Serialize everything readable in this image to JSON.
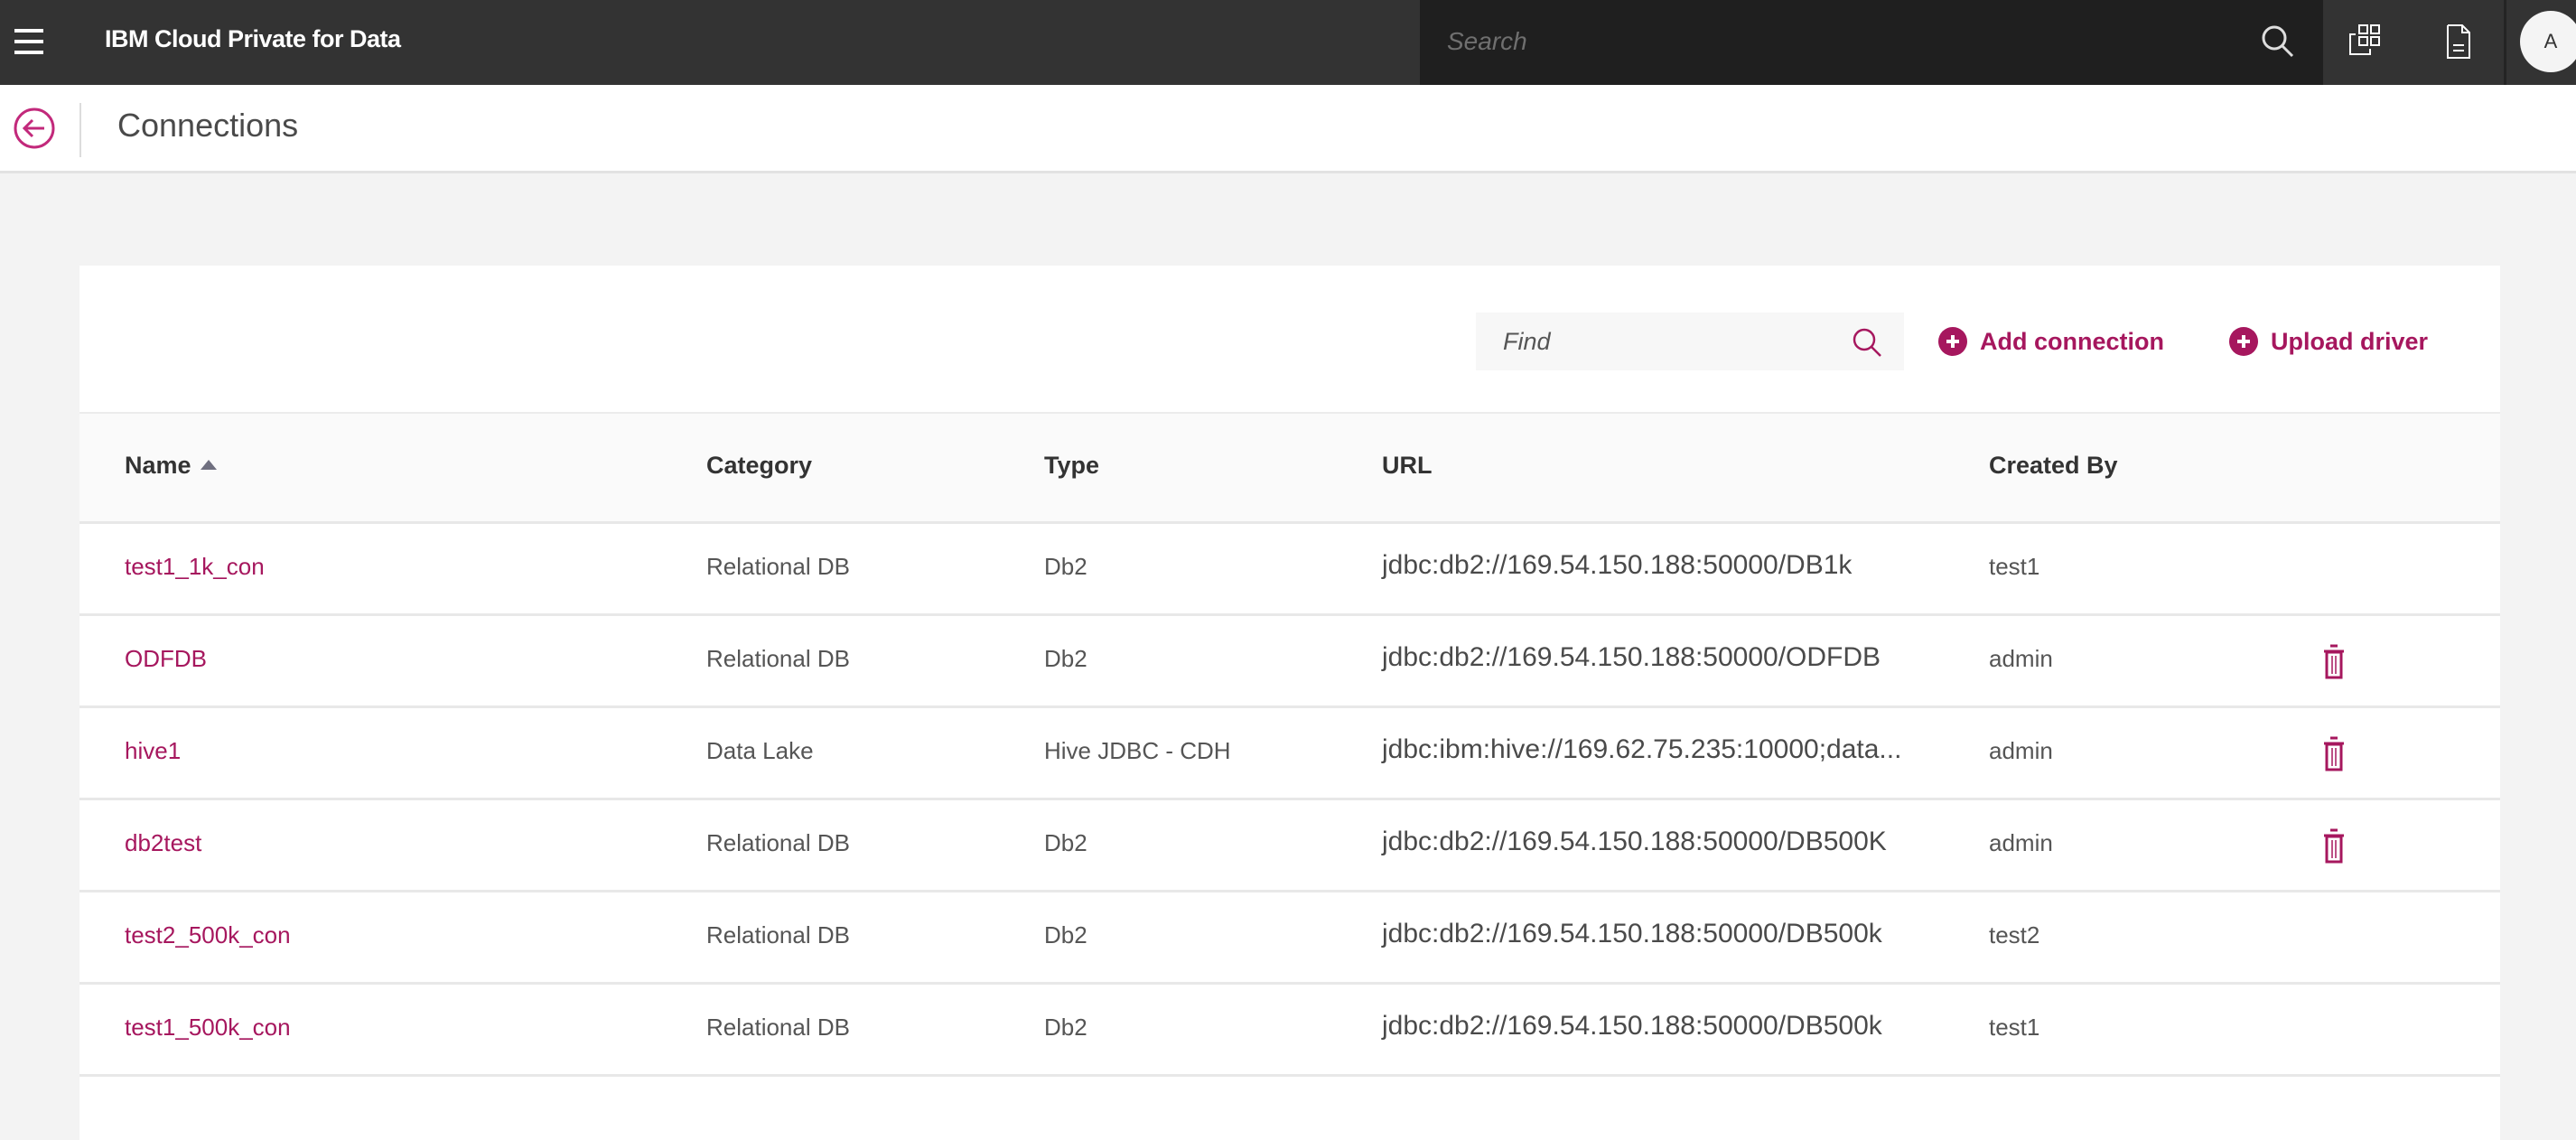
{
  "header": {
    "app_title": "IBM Cloud Private for Data",
    "search_placeholder": "Search",
    "avatar_initial": "A",
    "icons": [
      "menu-icon",
      "search-icon",
      "apps-icon",
      "document-icon"
    ]
  },
  "subheader": {
    "page_title": "Connections",
    "back_icon": "arrow-left-circle-icon"
  },
  "toolbar": {
    "find_placeholder": "Find",
    "add_connection_label": "Add connection",
    "upload_driver_label": "Upload driver"
  },
  "colors": {
    "accent": "#a6175e",
    "topbar": "#333333",
    "search_bg": "#1f1f1f"
  },
  "table": {
    "columns": [
      "Name",
      "Category",
      "Type",
      "URL",
      "Created By"
    ],
    "sort": {
      "column": "Name",
      "direction": "ascending"
    },
    "rows": [
      {
        "name": "test1_1k_con",
        "category": "Relational DB",
        "type": "Db2",
        "url": "jdbc:db2://169.54.150.188:50000/DB1k",
        "created_by": "test1",
        "deletable": false
      },
      {
        "name": "ODFDB",
        "category": "Relational DB",
        "type": "Db2",
        "url": "jdbc:db2://169.54.150.188:50000/ODFDB",
        "created_by": "admin",
        "deletable": true
      },
      {
        "name": "hive1",
        "category": "Data Lake",
        "type": "Hive JDBC - CDH",
        "url": "jdbc:ibm:hive://169.62.75.235:10000;data...",
        "created_by": "admin",
        "deletable": true
      },
      {
        "name": "db2test",
        "category": "Relational DB",
        "type": "Db2",
        "url": "jdbc:db2://169.54.150.188:50000/DB500K",
        "created_by": "admin",
        "deletable": true
      },
      {
        "name": "test2_500k_con",
        "category": "Relational DB",
        "type": "Db2",
        "url": "jdbc:db2://169.54.150.188:50000/DB500k",
        "created_by": "test2",
        "deletable": false
      },
      {
        "name": "test1_500k_con",
        "category": "Relational DB",
        "type": "Db2",
        "url": "jdbc:db2://169.54.150.188:50000/DB500k",
        "created_by": "test1",
        "deletable": false
      }
    ]
  }
}
